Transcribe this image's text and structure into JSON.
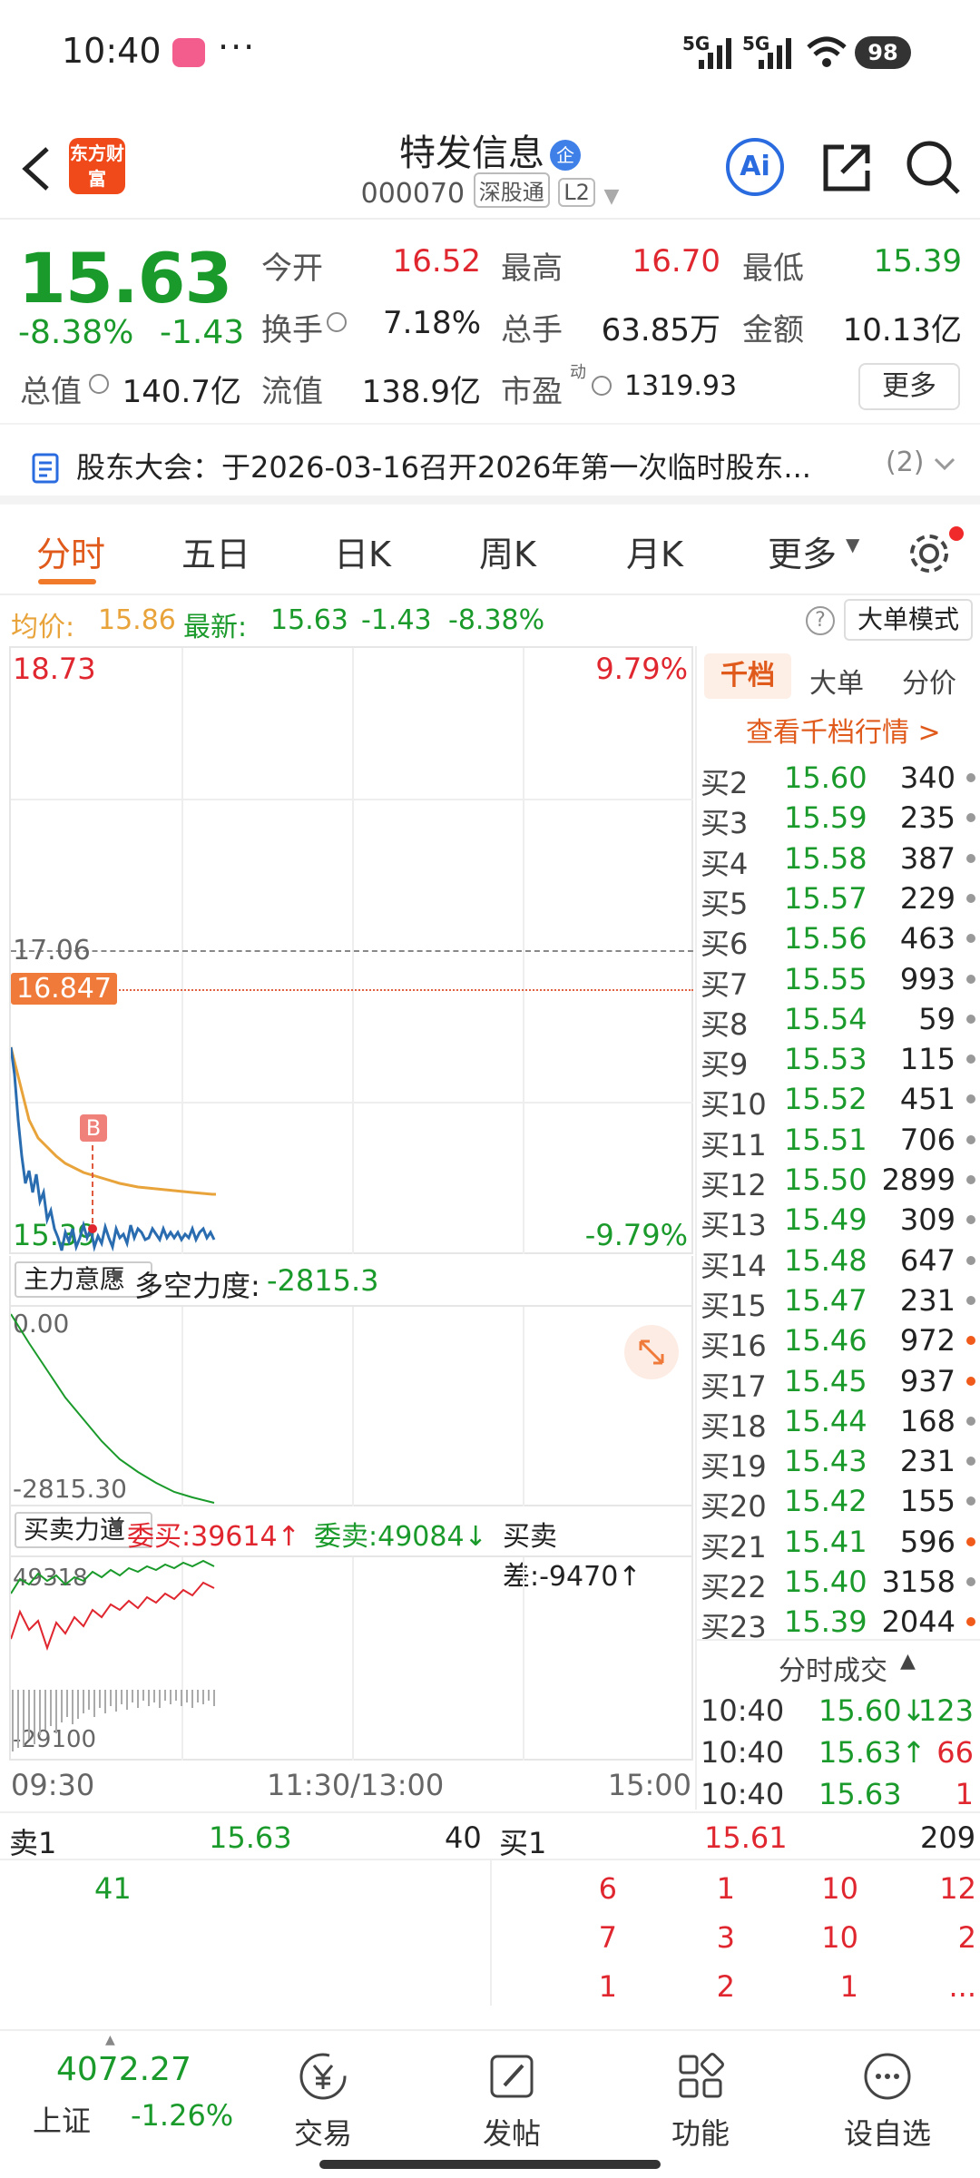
{
  "status": {
    "time": "10:40",
    "more": "···",
    "sig1": "5G",
    "sig2": "5G",
    "battery": "98"
  },
  "header": {
    "back": "<",
    "logo": "东方财富",
    "name": "特发信息",
    "qi": "企",
    "code": "000070",
    "tag1": "深股通",
    "tag2": "L2",
    "ai": "Ai"
  },
  "quote": {
    "price": "15.63",
    "change_pct": "-8.38%",
    "change": "-1.43",
    "open_label": "今开",
    "open": "16.52",
    "high_label": "最高",
    "high": "16.70",
    "low_label": "最低",
    "low": "15.39",
    "turnover_label": "换手",
    "turnover": "7.18%",
    "volume_label": "总手",
    "volume": "63.85万",
    "amount_label": "金额",
    "amount": "10.13亿",
    "mktcap_label": "总值",
    "mktcap": "140.7亿",
    "float_label": "流值",
    "float": "138.9亿",
    "pe_label": "市盈",
    "pe_sup": "动",
    "pe": "1319.93",
    "more_btn": "更多"
  },
  "announcement": {
    "text": "股东大会：于2026-03-16召开2026年第一次临时股东...",
    "count": "(2)"
  },
  "tabs": [
    "分时",
    "五日",
    "日K",
    "周K",
    "月K",
    "更多"
  ],
  "info": {
    "avg_label": "均价:",
    "avg": "15.86",
    "latest_label": "最新:",
    "latest": "15.63",
    "chg": "-1.43",
    "pct": "-8.38%",
    "mode_btn": "大单模式",
    "help": "?"
  },
  "chart": {
    "y_top": "18.73",
    "y_top_pct": "9.79%",
    "ref": "17.06",
    "ref_tag": "16.847",
    "y_bottom": "15.39",
    "y_bottom_pct": "-9.79%",
    "marker": "B",
    "x_start": "09:30",
    "x_mid": "11:30/13:00",
    "x_end": "15:00"
  },
  "panel2": {
    "selector": "主力意愿",
    "label": "多空力度:",
    "value": "-2815.3",
    "y_top": "0.00",
    "y_bottom": "-2815.30"
  },
  "panel3": {
    "selector": "买卖力道",
    "buy": "委买:39614↑",
    "sell": "委卖:49084↓",
    "diff": "买卖差:-9470↑",
    "y_top": "49318",
    "y_bottom": "-29100"
  },
  "orderbook": {
    "tabs": [
      "千档",
      "大单",
      "分价"
    ],
    "link": "查看千档行情 >",
    "rows": [
      {
        "n": "买2",
        "p": "15.60",
        "q": "340",
        "dot": "gray"
      },
      {
        "n": "买3",
        "p": "15.59",
        "q": "235",
        "dot": "gray"
      },
      {
        "n": "买4",
        "p": "15.58",
        "q": "387",
        "dot": "gray"
      },
      {
        "n": "买5",
        "p": "15.57",
        "q": "229",
        "dot": "gray"
      },
      {
        "n": "买6",
        "p": "15.56",
        "q": "463",
        "dot": "gray"
      },
      {
        "n": "买7",
        "p": "15.55",
        "q": "993",
        "dot": "gray"
      },
      {
        "n": "买8",
        "p": "15.54",
        "q": "59",
        "dot": "gray"
      },
      {
        "n": "买9",
        "p": "15.53",
        "q": "115",
        "dot": "gray"
      },
      {
        "n": "买10",
        "p": "15.52",
        "q": "451",
        "dot": "gray"
      },
      {
        "n": "买11",
        "p": "15.51",
        "q": "706",
        "dot": "gray"
      },
      {
        "n": "买12",
        "p": "15.50",
        "q": "2899",
        "dot": "gray"
      },
      {
        "n": "买13",
        "p": "15.49",
        "q": "309",
        "dot": "gray"
      },
      {
        "n": "买14",
        "p": "15.48",
        "q": "647",
        "dot": "gray"
      },
      {
        "n": "买15",
        "p": "15.47",
        "q": "231",
        "dot": "gray"
      },
      {
        "n": "买16",
        "p": "15.46",
        "q": "972",
        "dot": "orange"
      },
      {
        "n": "买17",
        "p": "15.45",
        "q": "937",
        "dot": "orange"
      },
      {
        "n": "买18",
        "p": "15.44",
        "q": "168",
        "dot": "gray"
      },
      {
        "n": "买19",
        "p": "15.43",
        "q": "231",
        "dot": "gray"
      },
      {
        "n": "买20",
        "p": "15.42",
        "q": "155",
        "dot": "gray"
      },
      {
        "n": "买21",
        "p": "15.41",
        "q": "596",
        "dot": "orange"
      },
      {
        "n": "买22",
        "p": "15.40",
        "q": "3158",
        "dot": "gray"
      },
      {
        "n": "买23",
        "p": "15.39",
        "q": "2044",
        "dot": "orange"
      }
    ],
    "ticks_title": "分时成交",
    "ticks": [
      {
        "t": "10:40",
        "p": "15.60↓",
        "v": "123",
        "pc": "green",
        "vc": "green"
      },
      {
        "t": "10:40",
        "p": "15.63↑",
        "v": "66",
        "pc": "green",
        "vc": "red"
      },
      {
        "t": "10:40",
        "p": "15.63",
        "v": "1",
        "pc": "green",
        "vc": "red"
      }
    ]
  },
  "sell1": {
    "label": "卖1",
    "price": "15.63",
    "qty": "40",
    "queue": [
      "41"
    ]
  },
  "buy1": {
    "label": "买1",
    "price": "15.61",
    "qty": "209",
    "queue": [
      "6",
      "1",
      "10",
      "12",
      "7",
      "3",
      "10",
      "2",
      "1",
      "2",
      "1",
      "..."
    ]
  },
  "bottom": {
    "index_value": "4072.27",
    "index_name": "上证",
    "index_pct": "-1.26%",
    "items": [
      {
        "label": "交易",
        "icon": "yen-icon"
      },
      {
        "label": "发帖",
        "icon": "edit-icon"
      },
      {
        "label": "功能",
        "icon": "grid-icon"
      },
      {
        "label": "设自选",
        "icon": "more-icon"
      }
    ]
  },
  "colors": {
    "up": "#e0262f",
    "down": "#1a9a2a",
    "accent": "#e05a1c",
    "avg_line": "#e8a33a",
    "price_line": "#2a6cb0"
  }
}
